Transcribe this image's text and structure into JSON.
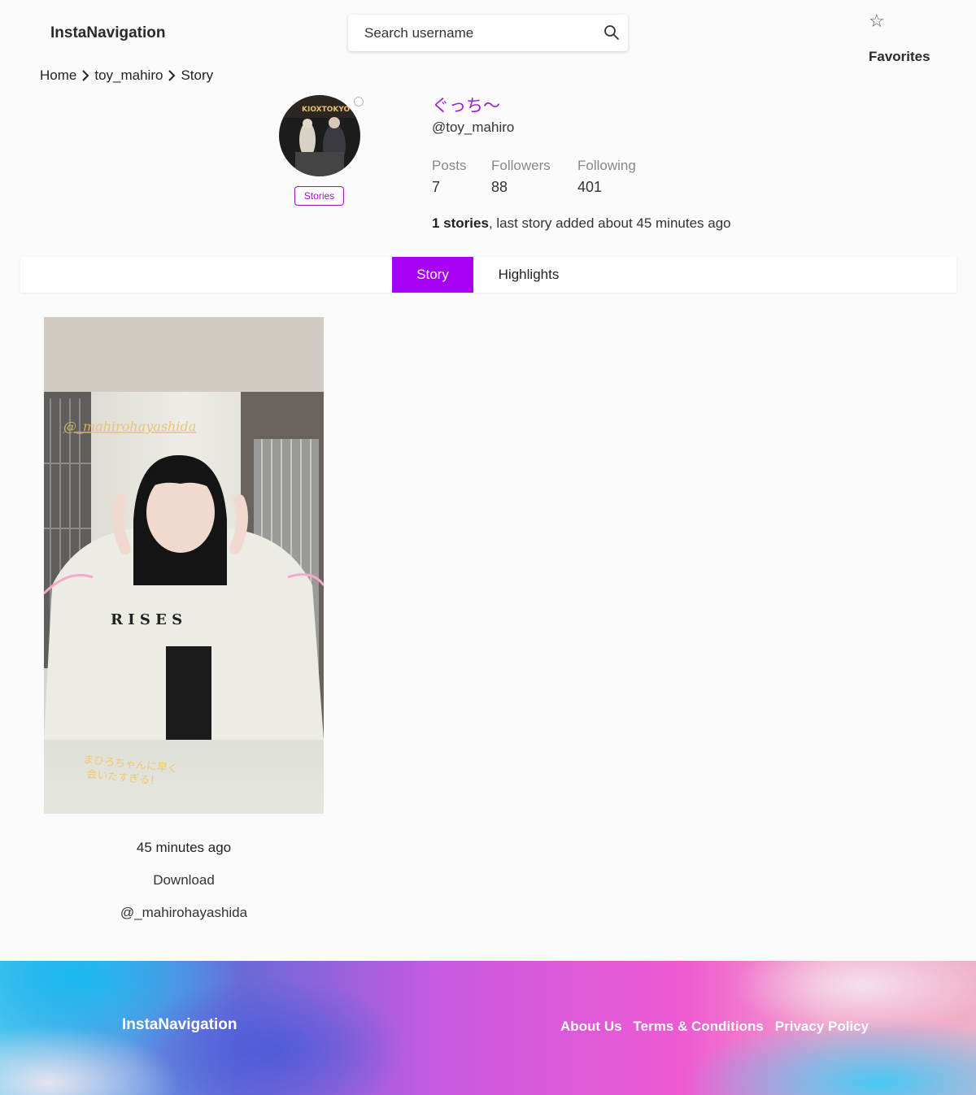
{
  "header": {
    "logo": "InstaNavigation",
    "search_placeholder": "Search username",
    "favorites_label": "Favorites"
  },
  "breadcrumb": {
    "home": "Home",
    "profile": "toy_mahiro",
    "current": "Story"
  },
  "profile": {
    "display_name": "ぐっち〜",
    "username": "@toy_mahiro",
    "stories_button": "Stories",
    "stats": {
      "posts_label": "Posts",
      "posts_value": "7",
      "followers_label": "Followers",
      "followers_value": "88",
      "following_label": "Following",
      "following_value": "401"
    },
    "stories_count": "1 stories",
    "stories_suffix": ", last story added about 45 minutes ago"
  },
  "tabs": {
    "story": "Story",
    "highlights": "Highlights"
  },
  "story": {
    "time": "45 minutes ago",
    "download": "Download",
    "mention": "@_mahirohayashida"
  },
  "footer": {
    "logo": "InstaNavigation",
    "links": {
      "about": "About Us",
      "terms": "Terms & Conditions",
      "privacy": "Privacy Policy"
    }
  },
  "colors": {
    "accent": "#a600f5",
    "display_name": "#a21ad6",
    "stories_border": "#a010c8"
  }
}
